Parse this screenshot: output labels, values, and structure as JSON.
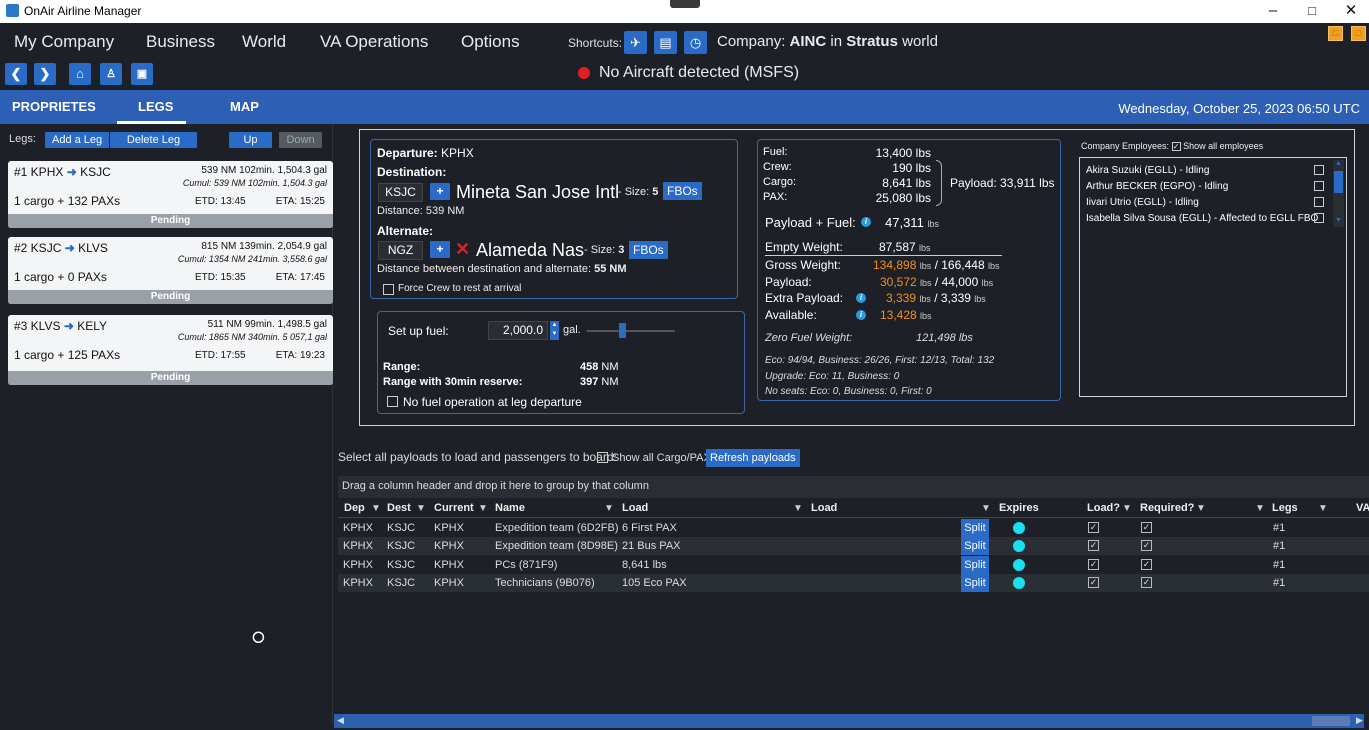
{
  "window": {
    "title": "OnAir Airline Manager"
  },
  "menu": {
    "items": [
      "My Company",
      "Business",
      "World",
      "VA Operations",
      "Options"
    ],
    "shortcuts_label": "Shortcuts:"
  },
  "company": {
    "prefix": "Company:",
    "code": "AINC",
    "in": "in",
    "world": "Stratus",
    "suffix": "world"
  },
  "status": {
    "aircraft": "No Aircraft detected (MSFS)"
  },
  "tabs": {
    "items": [
      "PROPRIETES",
      "LEGS",
      "MAP"
    ],
    "active": "LEGS"
  },
  "date": "Wednesday, October 25, 2023 06:50 UTC",
  "legs_panel": {
    "label": "Legs:",
    "add": "Add a Leg",
    "delete": "Delete Leg",
    "up": "Up",
    "down": "Down",
    "legs": [
      {
        "title": "#1 KPHX",
        "to": "KSJC",
        "line1": "539 NM  102min.  1,504.3 gal",
        "line2": "Cumul: 539 NM  102min.  1,504.3 gal",
        "pax": "1 cargo + 132 PAXs",
        "etd": "ETD: 13:45",
        "eta": "ETA: 15:25",
        "status": "Pending"
      },
      {
        "title": "#2  KSJC",
        "to": "KLVS",
        "line1": "815 NM  139min.  2,054.9 gal",
        "line2": "Cumul: 1354 NM  241min.  3,558.6 gal",
        "pax": "1 cargo + 0 PAXs",
        "etd": "ETD: 15:35",
        "eta": "ETA: 17:45",
        "status": "Pending"
      },
      {
        "title": "#3  KLVS",
        "to": "KELY",
        "line1": "511 NM  99min.  1,498.5 gal",
        "line2": "Cumul: 1865 NM  340min.  5 057,1 gal",
        "pax": "1 cargo + 125 PAXs",
        "etd": "ETD: 17:55",
        "eta": "ETA: 19:23",
        "status": "Pending"
      }
    ]
  },
  "route": {
    "departure_label": "Departure:",
    "departure": "KPHX",
    "destination_label": "Destination:",
    "dest_code": "KSJC",
    "dest_name": "Mineta San Jose Intl",
    "size_label": "- Size:",
    "dest_size": "5",
    "fbos": "FBOs",
    "distance": "Distance: 539 NM",
    "alternate_label": "Alternate:",
    "alt_code": "NGZ",
    "alt_name": "Alameda Nas",
    "alt_size": "3",
    "alt_distance_label": "Distance between destination and alternate:",
    "alt_distance": "55 NM",
    "force_crew": "Force Crew to rest at arrival"
  },
  "fuel": {
    "setup_label": "Set up fuel:",
    "value": "2,000.0",
    "unit": "gal.",
    "range_label": "Range:",
    "range": "458",
    "range_unit": "NM",
    "reserve_label": "Range with 30min reserve:",
    "reserve": "397",
    "no_fuel": "No fuel operation at leg departure"
  },
  "weights": {
    "fuel_l": "Fuel:",
    "fuel": "13,400 lbs",
    "crew_l": "Crew:",
    "crew": "190 lbs",
    "cargo_l": "Cargo:",
    "cargo": "8,641 lbs",
    "pax_l": "PAX:",
    "pax": "25,080 lbs",
    "payload_sum": "Payload: 33,911 lbs",
    "pf_l": "Payload + Fuel:",
    "pf": "47,311",
    "lbs": "lbs",
    "empty_l": "Empty Weight:",
    "empty": "87,587",
    "gross_l": "Gross Weight:",
    "gross": "134,898",
    "gross_max": "/ 166,448",
    "payload_l": "Payload:",
    "payload": "30,572",
    "payload_max": "/ 44,000",
    "extra_l": "Extra Payload:",
    "extra": "3,339",
    "extra_max": "/ 3,339",
    "avail_l": "Available:",
    "avail": "13,428",
    "zfw_l": "Zero Fuel Weight:",
    "zfw": "121,498 lbs",
    "seats1": "Eco: 94/94, Business: 26/26, First: 12/13, Total: 132",
    "seats2": "Upgrade: Eco: 11, Business: 0",
    "seats3": "No seats: Eco: 0, Business: 0, First: 0"
  },
  "employees": {
    "label": "Company Employees:",
    "show_all": "Show all employees",
    "list": [
      "Akira Suzuki (EGLL) - Idling",
      "Arthur BECKER (EGPO) - Idling",
      "Iivari Utrio (EGLL) - Idling",
      "Isabella Silva Sousa (EGLL) - Affected to EGLL FBO"
    ]
  },
  "payloads": {
    "select_label": "Select all payloads to load and passengers to board:",
    "show_all": "Show all Cargo/PAX",
    "refresh": "Refresh payloads",
    "group_hint": "Drag a column header and drop it here to group by that column",
    "columns": [
      "Dep",
      "Dest",
      "Current",
      "Name",
      "Load",
      "Load",
      "Expires",
      "Load?",
      "Required?",
      "Legs",
      "VA"
    ],
    "rows": [
      {
        "dep": "KPHX",
        "dest": "KSJC",
        "current": "KPHX",
        "name": "Expedition team (6D2FB)",
        "load": "6 First PAX",
        "split": "Split",
        "legs": "#1"
      },
      {
        "dep": "KPHX",
        "dest": "KSJC",
        "current": "KPHX",
        "name": "Expedition team (8D98E)",
        "load": "21 Bus PAX",
        "split": "Split",
        "legs": "#1"
      },
      {
        "dep": "KPHX",
        "dest": "KSJC",
        "current": "KPHX",
        "name": "PCs (871F9)",
        "load": "8,641 lbs",
        "split": "Split",
        "legs": "#1"
      },
      {
        "dep": "KPHX",
        "dest": "KSJC",
        "current": "KPHX",
        "name": "Technicians (9B076)",
        "load": "105 Eco PAX",
        "split": "Split",
        "legs": "#1"
      }
    ]
  },
  "fuel_slider_level": 0.4
}
